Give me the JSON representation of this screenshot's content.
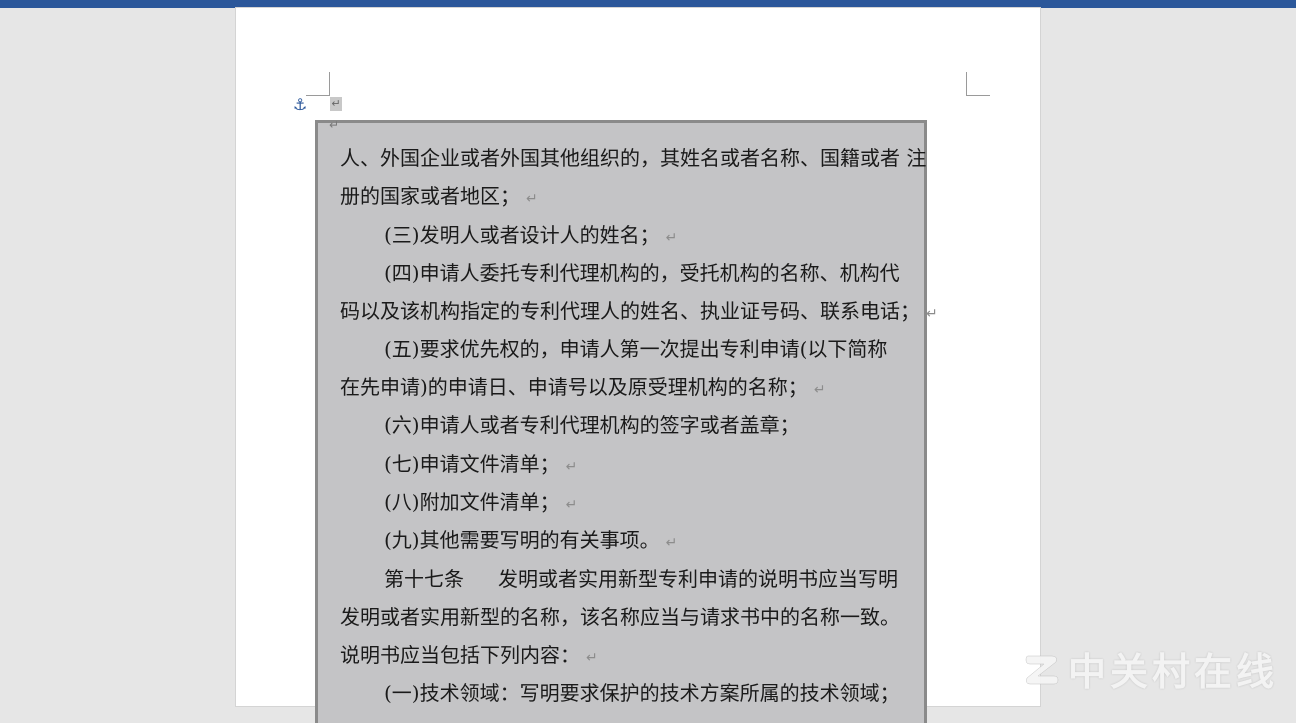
{
  "document": {
    "anchor_icon": "anchor-icon",
    "paragraph_mark": "↵",
    "lines": [
      {
        "text": "人、外国企业或者外国其他组织的，其姓名或者名称、国籍或者 注",
        "mark": ""
      },
      {
        "text": "册的国家或者地区；",
        "mark": "↵"
      },
      {
        "text": "(三)发明人或者设计人的姓名；",
        "mark": "↵"
      },
      {
        "text": "(四)申请人委托专利代理机构的，受托机构的名称、机构代",
        "mark": ""
      },
      {
        "text": "码以及该机构指定的专利代理人的姓名、执业证号码、联系电话；",
        "mark": "↵"
      },
      {
        "text": "(五)要求优先权的，申请人第一次提出专利申请(以下简称",
        "mark": ""
      },
      {
        "text": "在先申请)的申请日、申请号以及原受理机构的名称；",
        "mark": "↵"
      },
      {
        "text": "(六)申请人或者专利代理机构的签字或者盖章；",
        "mark": ""
      },
      {
        "text": "(七)申请文件清单；",
        "mark": "↵"
      },
      {
        "text": "(八)附加文件清单；",
        "mark": "↵"
      },
      {
        "text": "(九)其他需要写明的有关事项。",
        "mark": "↵"
      },
      {
        "text_a": "第十七条",
        "text_b": "发明或者实用新型专利申请的说明书应当写明",
        "mark": ""
      },
      {
        "text": "发明或者实用新型的名称，该名称应当与请求书中的名称一致。",
        "mark": ""
      },
      {
        "text": "说明书应当包括下列内容：",
        "mark": "↵"
      },
      {
        "text": "(一)技术领域：写明要求保护的技术方案所属的技术领域；",
        "mark": ""
      }
    ]
  },
  "watermark": {
    "text": "中关村在线",
    "logo_icon": "zol-logo-icon"
  },
  "colors": {
    "title_bar": "#2b579a",
    "textbox_fill": "#c4c4c6",
    "textbox_border": "#8a8a8a",
    "page": "#ffffff",
    "canvas": "#e6e6e6"
  }
}
